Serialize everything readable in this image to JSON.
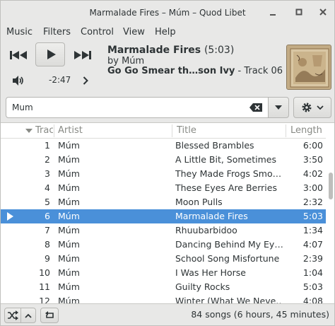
{
  "window": {
    "title": "Marmalade Fires – Múm – Quod Libet"
  },
  "menu": [
    "Music",
    "Filters",
    "Control",
    "View",
    "Help"
  ],
  "now_playing": {
    "title": "Marmalade Fires",
    "length": "(5:03)",
    "by": "by Múm",
    "album": "Go Go Smear th…son Ivy",
    "track": " - Track 06",
    "time_remaining": "-2:47"
  },
  "search": {
    "value": "Mum"
  },
  "columns": {
    "track": "Track",
    "artist": "Artist",
    "title": "Title",
    "length": "Length"
  },
  "rows": [
    {
      "num": "1",
      "artist": "Múm",
      "title": "Blessed Brambles",
      "length": "6:00"
    },
    {
      "num": "2",
      "artist": "Múm",
      "title": "A Little Bit, Sometimes",
      "length": "3:50"
    },
    {
      "num": "3",
      "artist": "Múm",
      "title": "They Made Frogs Smo…",
      "length": "4:02"
    },
    {
      "num": "4",
      "artist": "Múm",
      "title": "These Eyes Are Berries",
      "length": "3:00"
    },
    {
      "num": "5",
      "artist": "Múm",
      "title": "Moon Pulls",
      "length": "2:32"
    },
    {
      "num": "6",
      "artist": "Múm",
      "title": "Marmalade Fires",
      "length": "5:03"
    },
    {
      "num": "7",
      "artist": "Múm",
      "title": "Rhuubarbidoo",
      "length": "1:34"
    },
    {
      "num": "8",
      "artist": "Múm",
      "title": "Dancing Behind My Ey…",
      "length": "4:07"
    },
    {
      "num": "9",
      "artist": "Múm",
      "title": "School Song Misfortune",
      "length": "2:39"
    },
    {
      "num": "10",
      "artist": "Múm",
      "title": "I Was Her Horse",
      "length": "1:04"
    },
    {
      "num": "11",
      "artist": "Múm",
      "title": "Guilty Rocks",
      "length": "5:03"
    },
    {
      "num": "12",
      "artist": "Múm",
      "title": "Winter (What We Neve…",
      "length": "4:08"
    }
  ],
  "selected_row": 5,
  "status": {
    "summary": "84 songs (6 hours, 45 minutes)"
  },
  "icons": {
    "prev": "skip-backward-icon",
    "play": "play-icon",
    "next": "skip-forward-icon",
    "volume": "volume-icon",
    "seek": "chevron-right-icon",
    "clear": "clear-text-icon",
    "dropdown": "chevron-down-icon",
    "settings": "gear-icon",
    "shuffle": "shuffle-icon",
    "up": "chevron-up-icon",
    "repeat": "repeat-icon"
  },
  "colors": {
    "selection": "#4a90d9",
    "background": "#e8e8e7"
  }
}
